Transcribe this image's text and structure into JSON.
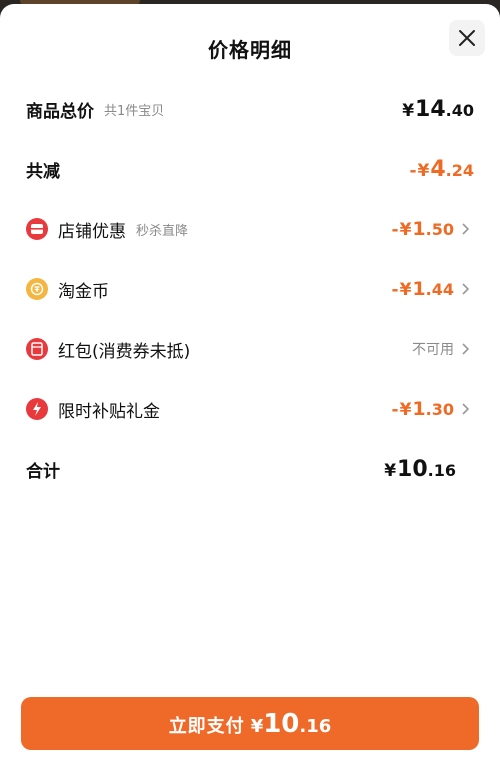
{
  "header": {
    "title": "价格明细"
  },
  "rows": {
    "total": {
      "label": "商品总价",
      "sub": "共1件宝贝",
      "yen": "¥",
      "int": "14",
      "dec": ".40"
    },
    "reduce": {
      "label": "共减",
      "prefix": "-",
      "yen": "¥",
      "int": "4",
      "dec": ".24"
    },
    "store": {
      "label": "店铺优惠",
      "sub": "秒杀直降",
      "prefix": "-",
      "yen": "¥",
      "int": "1",
      "dec": ".50",
      "icon": "store-coupon-icon"
    },
    "coins": {
      "label": "淘金币",
      "prefix": "-",
      "yen": "¥",
      "int": "1",
      "dec": ".44",
      "icon": "coin-icon"
    },
    "redpacket": {
      "label": "红包(消费券未抵)",
      "status": "不可用",
      "icon": "red-packet-icon"
    },
    "subsidy": {
      "label": "限时补贴礼金",
      "prefix": "-",
      "yen": "¥",
      "int": "1",
      "dec": ".30",
      "icon": "lightning-icon"
    },
    "sum": {
      "label": "合计",
      "yen": "¥",
      "int": "10",
      "dec": ".16"
    }
  },
  "pay": {
    "label": "立即支付",
    "yen": "¥",
    "int": "10",
    "dec": ".16"
  },
  "colors": {
    "accent": "#ef6a24",
    "button": "#ef6a28",
    "icon_red": "#e8393d",
    "icon_gold": "#f5b640"
  }
}
